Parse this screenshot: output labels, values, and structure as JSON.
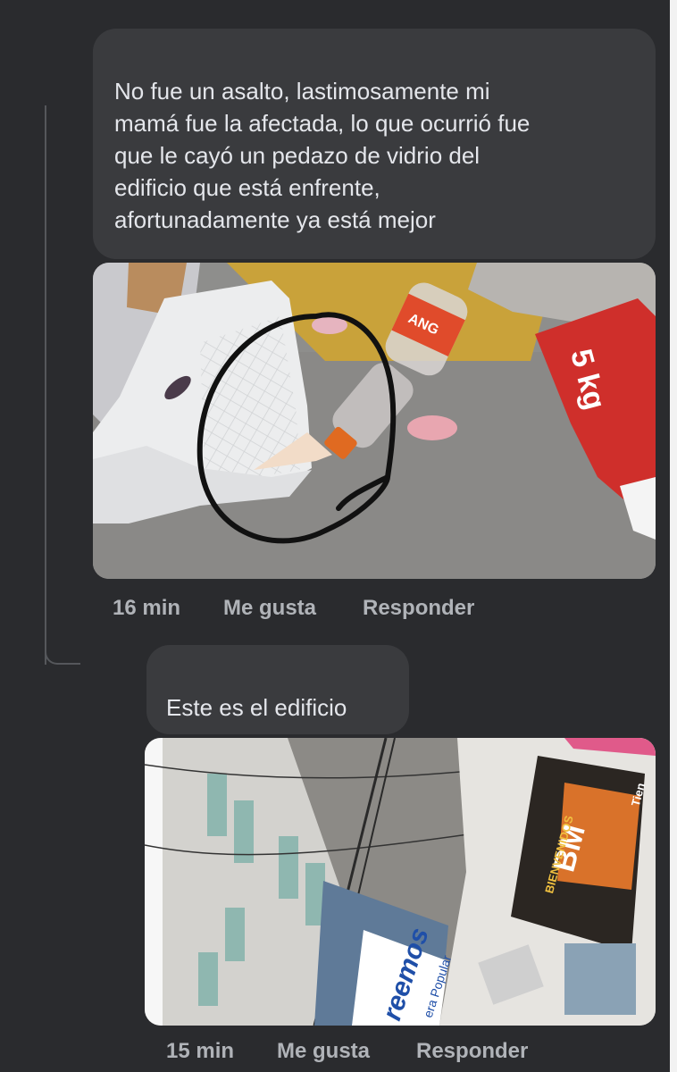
{
  "comment1": {
    "text": "No fue un asalto, lastimosamente mi\nmamá fue la afectada, lo que ocurrió fue\nque le cayó un pedazo de vidrio del\nedificio que está enfrente,\nafortunadamente ya está mejor",
    "photo": {
      "bottle_label": "ANG",
      "bag_label": "5 kg"
    },
    "time": "16 min",
    "like_label": "Me gusta",
    "reply_label": "Responder"
  },
  "comment2": {
    "text": "Este es el edificio",
    "photo": {
      "sign_left": "reemos",
      "sign_left_sub": "era Popular",
      "banner_title": "BM",
      "banner_sub": "BIENVENIDOS",
      "banner_side": "Tien"
    },
    "time": "15 min",
    "like_label": "Me gusta",
    "reply_label": "Responder"
  }
}
